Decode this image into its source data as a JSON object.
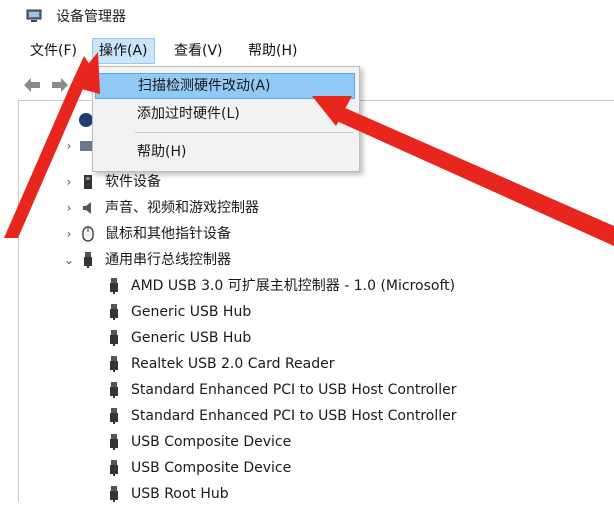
{
  "window": {
    "title": "设备管理器"
  },
  "menubar": {
    "file": "文件(F)",
    "action": "操作(A)",
    "view": "查看(V)",
    "help": "帮助(H)"
  },
  "toolbar": {
    "back_icon": "arrow-left-icon",
    "forward_icon": "arrow-right-icon"
  },
  "dropdown": {
    "items": [
      {
        "label": "扫描检测硬件改动(A)",
        "highlighted": true
      },
      {
        "label": "添加过时硬件(L)",
        "highlighted": false
      },
      {
        "label": "帮助(H)",
        "highlighted": false
      }
    ]
  },
  "tree": {
    "categories": [
      {
        "label": "软件设备",
        "expanded": false,
        "icon": "software-device-icon"
      },
      {
        "label": "声音、视频和游戏控制器",
        "expanded": false,
        "icon": "speaker-icon"
      },
      {
        "label": "鼠标和其他指针设备",
        "expanded": false,
        "icon": "mouse-icon"
      },
      {
        "label": "通用串行总线控制器",
        "expanded": true,
        "icon": "usb-icon"
      }
    ],
    "usb_children": [
      "AMD USB 3.0 可扩展主机控制器 - 1.0 (Microsoft)",
      "Generic USB Hub",
      "Generic USB Hub",
      "Realtek USB 2.0 Card Reader",
      "Standard Enhanced PCI to USB Host Controller",
      "Standard Enhanced PCI to USB Host Controller",
      "USB Composite Device",
      "USB Composite Device",
      "USB Root Hub"
    ]
  },
  "colors": {
    "arrow": "#e8261e",
    "highlight": "#91c9f7",
    "menu_active": "#cce4f7"
  }
}
